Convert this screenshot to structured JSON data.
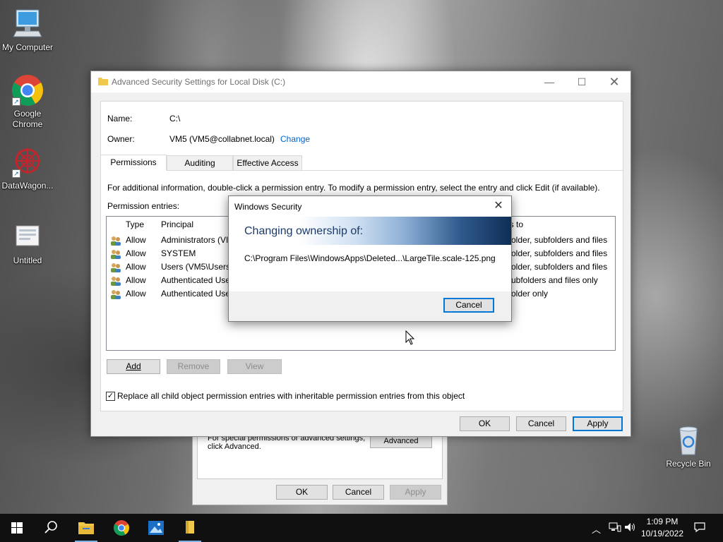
{
  "desktop": {
    "icons": [
      {
        "label": "My Computer"
      },
      {
        "label": "Google Chrome"
      },
      {
        "label": "DataWagon..."
      },
      {
        "label": "Untitled"
      },
      {
        "label": "Recycle Bin"
      }
    ]
  },
  "back_dialog": {
    "note": "For special permissions or advanced settings, click Advanced.",
    "advanced_label": "Advanced",
    "ok_label": "OK",
    "cancel_label": "Cancel",
    "apply_label": "Apply"
  },
  "main_window": {
    "title": "Advanced Security Settings for Local Disk (C:)",
    "name_label": "Name:",
    "name_value": "C:\\",
    "owner_label": "Owner:",
    "owner_value": "VM5 (VM5@collabnet.local)",
    "change_link": "Change",
    "tabs": [
      {
        "label": "Permissions"
      },
      {
        "label": "Auditing"
      },
      {
        "label": "Effective Access"
      }
    ],
    "info_text": "For additional information, double-click a permission entry. To modify a permission entry, select the entry and click Edit (if available).",
    "entries_label": "Permission entries:",
    "columns": {
      "type": "Type",
      "principal": "Principal",
      "applies_to": "es to"
    },
    "rows": [
      {
        "type": "Allow",
        "principal": "Administrators (VI",
        "applies_to": "older, subfolders and files"
      },
      {
        "type": "Allow",
        "principal": "SYSTEM",
        "applies_to": "older, subfolders and files"
      },
      {
        "type": "Allow",
        "principal": "Users (VM5\\Users)",
        "applies_to": "older, subfolders and files"
      },
      {
        "type": "Allow",
        "principal": "Authenticated Use",
        "applies_to": "ubfolders and files only"
      },
      {
        "type": "Allow",
        "principal": "Authenticated Use",
        "applies_to": "older only"
      }
    ],
    "add_label": "Add",
    "remove_label": "Remove",
    "view_label": "View",
    "replace_checkbox_label": "Replace all child object permission entries with inheritable permission entries from this object",
    "replace_checked": true,
    "ok_label": "OK",
    "cancel_label": "Cancel",
    "apply_label": "Apply"
  },
  "security_modal": {
    "title": "Windows Security",
    "heading": "Changing ownership of:",
    "path": "C:\\Program Files\\WindowsApps\\Deleted...\\LargeTile.scale-125.png",
    "cancel_label": "Cancel"
  },
  "taskbar": {
    "time": "1:09 PM",
    "date": "10/19/2022"
  }
}
